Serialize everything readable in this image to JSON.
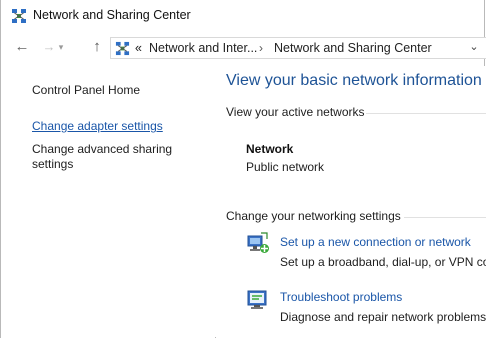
{
  "window": {
    "title": "Network and Sharing Center"
  },
  "nav": {
    "back": "←",
    "forward": "→",
    "forward_dropdown": "▾",
    "up": "↑"
  },
  "address": {
    "overflow": "«",
    "crumbs": [
      "Network and Inter...",
      "Network and Sharing Center"
    ],
    "separator": "›",
    "dropdown": "⌄"
  },
  "left_pane": {
    "home": "Control Panel Home",
    "links": [
      "Change adapter settings",
      "Change advanced sharing settings"
    ]
  },
  "main": {
    "title": "View your basic network information",
    "active_networks_header": "View your active networks",
    "network": {
      "name": "Network",
      "type": "Public network"
    },
    "change_settings_header": "Change your networking settings",
    "tasks": [
      {
        "label": "Set up a new connection or network",
        "desc": "Set up a broadband, dial-up, or VPN co",
        "icon": "new-connection-icon"
      },
      {
        "label": "Troubleshoot problems",
        "desc": "Diagnose and repair network problems,",
        "icon": "troubleshoot-icon"
      }
    ]
  },
  "colors": {
    "link": "#1a56a8",
    "title": "#1e5396"
  }
}
